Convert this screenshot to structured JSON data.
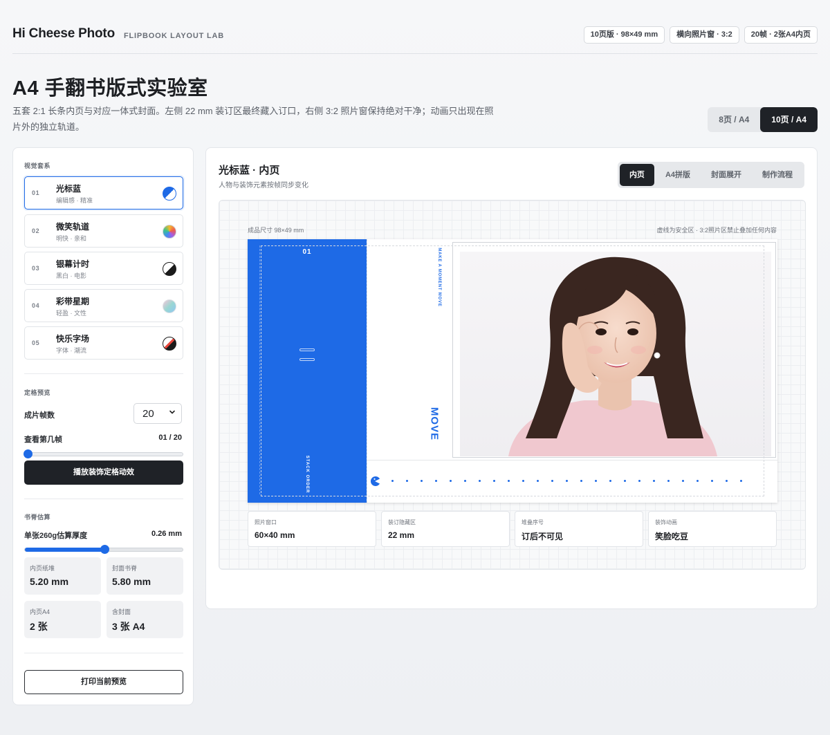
{
  "header": {
    "brand": "Hi Cheese Photo",
    "brand_sub": "FLIPBOOK LAYOUT LAB",
    "chips": [
      "10页版 · 98×49 mm",
      "横向照片窗 · 3:2",
      "20帧 · 2张A4内页"
    ]
  },
  "hero": {
    "title": "A4 手翻书版式实验室",
    "desc": "五套 2:1 长条内页与对应一体式封面。左侧 22 mm 装订区最终藏入订口，右侧 3:2 照片窗保持绝对干净；动画只出现在照片外的独立轨道。",
    "segments": [
      "8页 / A4",
      "10页 / A4"
    ],
    "active_segment": 1
  },
  "sidebar": {
    "themes_label": "视觉套系",
    "themes": [
      {
        "num": "01",
        "name": "光标蓝",
        "desc": "编辑感 · 精准",
        "active": true
      },
      {
        "num": "02",
        "name": "微笑轨道",
        "desc": "明快 · 亲和",
        "active": false
      },
      {
        "num": "03",
        "name": "银幕计时",
        "desc": "黑白 · 电影",
        "active": false
      },
      {
        "num": "04",
        "name": "彩带星期",
        "desc": "轻盈 · 文性",
        "active": false
      },
      {
        "num": "05",
        "name": "快乐字场",
        "desc": "字体 · 潮流",
        "active": false
      }
    ],
    "frame_label": "定格预览",
    "frame_count_label": "成片帧数",
    "frame_count_value": "20",
    "view_frame_label": "查看第几帧",
    "view_frame_value": "01 / 20",
    "frame_progress": 0.0,
    "play_button": "播放装饰定格动效",
    "spine_label": "书脊估算",
    "thickness_label": "单张260g估算厚度",
    "thickness_value": "0.26 mm",
    "thickness_progress": 0.5,
    "stats": [
      {
        "label": "内页纸堆",
        "value": "5.20 mm"
      },
      {
        "label": "封面书脊",
        "value": "5.80 mm"
      },
      {
        "label": "内页A4",
        "value": "2 张"
      },
      {
        "label": "含封面",
        "value": "3 张 A4"
      }
    ],
    "print_button": "打印当前预览"
  },
  "main": {
    "title": "光标蓝 · 内页",
    "subtitle": "人物与装饰元素按帧同步变化",
    "tabs": [
      "内页",
      "A4拼版",
      "封面展开",
      "制作流程"
    ],
    "active_tab": 0,
    "canvas_left_note": "成品尺寸 98×49 mm",
    "canvas_right_note": "虚线为安全区 · 3:2照片区禁止叠加任何内容",
    "page_number": "01",
    "tagline": "MAKE A MOMENT MOVE",
    "move_text": "MOVE",
    "stack_text": "STACK ORDER",
    "info": [
      {
        "label": "照片窗口",
        "value": "60×40 mm"
      },
      {
        "label": "装订隐藏区",
        "value": "22 mm"
      },
      {
        "label": "堆叠序号",
        "value": "订后不可见"
      },
      {
        "label": "装饰动画",
        "value": "笑脸吃豆"
      }
    ]
  },
  "colors": {
    "accent": "#1e6ae6",
    "dark": "#1f2227"
  },
  "icons": {
    "select_arrow": "chevron-down-icon",
    "pacman": "pacman-icon"
  }
}
